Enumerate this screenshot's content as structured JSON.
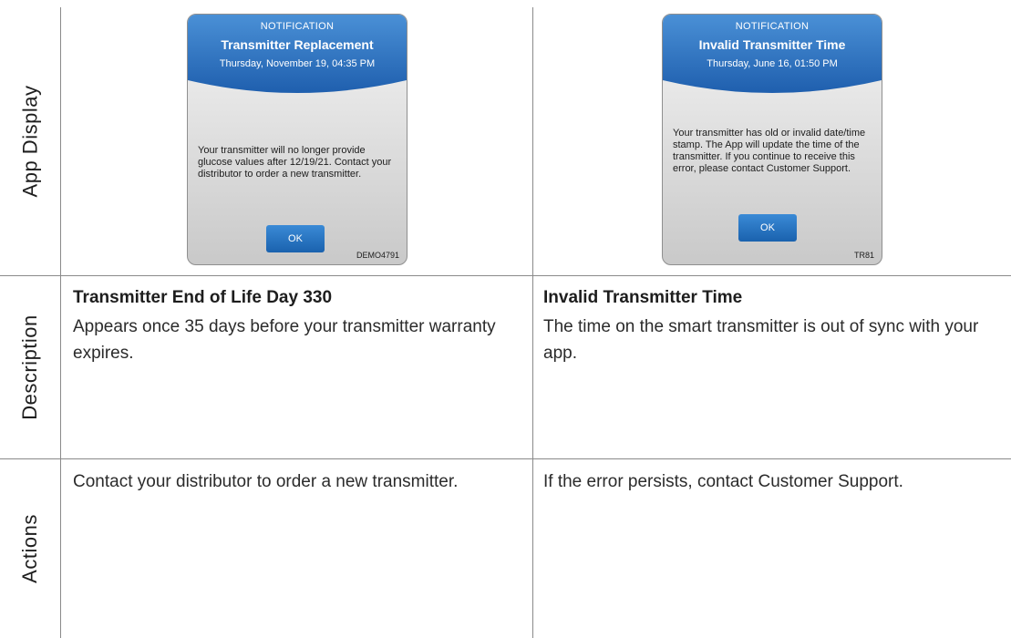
{
  "row_labels": {
    "app_display": "App Display",
    "description": "Description",
    "actions": "Actions"
  },
  "columns": [
    {
      "notification": {
        "label": "NOTIFICATION",
        "title": "Transmitter Replacement",
        "date": "Thursday, November 19, 04:35 PM",
        "message": "Your transmitter will no longer provide glucose values after 12/19/21. Contact your distributor to order a new transmitter.",
        "button": "OK",
        "code": "DEMO4791"
      },
      "description_title": "Transmitter End of Life Day 330",
      "description_text": "Appears once 35 days before your transmitter warranty expires.",
      "actions_text": "Contact your distributor to order a new transmitter."
    },
    {
      "notification": {
        "label": "NOTIFICATION",
        "title": "Invalid Transmitter Time",
        "date": "Thursday, June 16, 01:50 PM",
        "message": "Your transmitter has old or invalid date/time stamp. The App will update the time of the transmitter. If you continue to receive this error, please contact Customer Support.",
        "button": "OK",
        "code": "TR81"
      },
      "description_title": "Invalid Transmitter Time",
      "description_text": "The time on the smart transmitter is out of sync with your app.",
      "actions_text": "If the error persists, contact Customer Support."
    }
  ],
  "colors": {
    "header_blue_top": "#4a90d6",
    "header_blue_bottom": "#1f5fae",
    "grid_line": "#8a8a8a"
  }
}
